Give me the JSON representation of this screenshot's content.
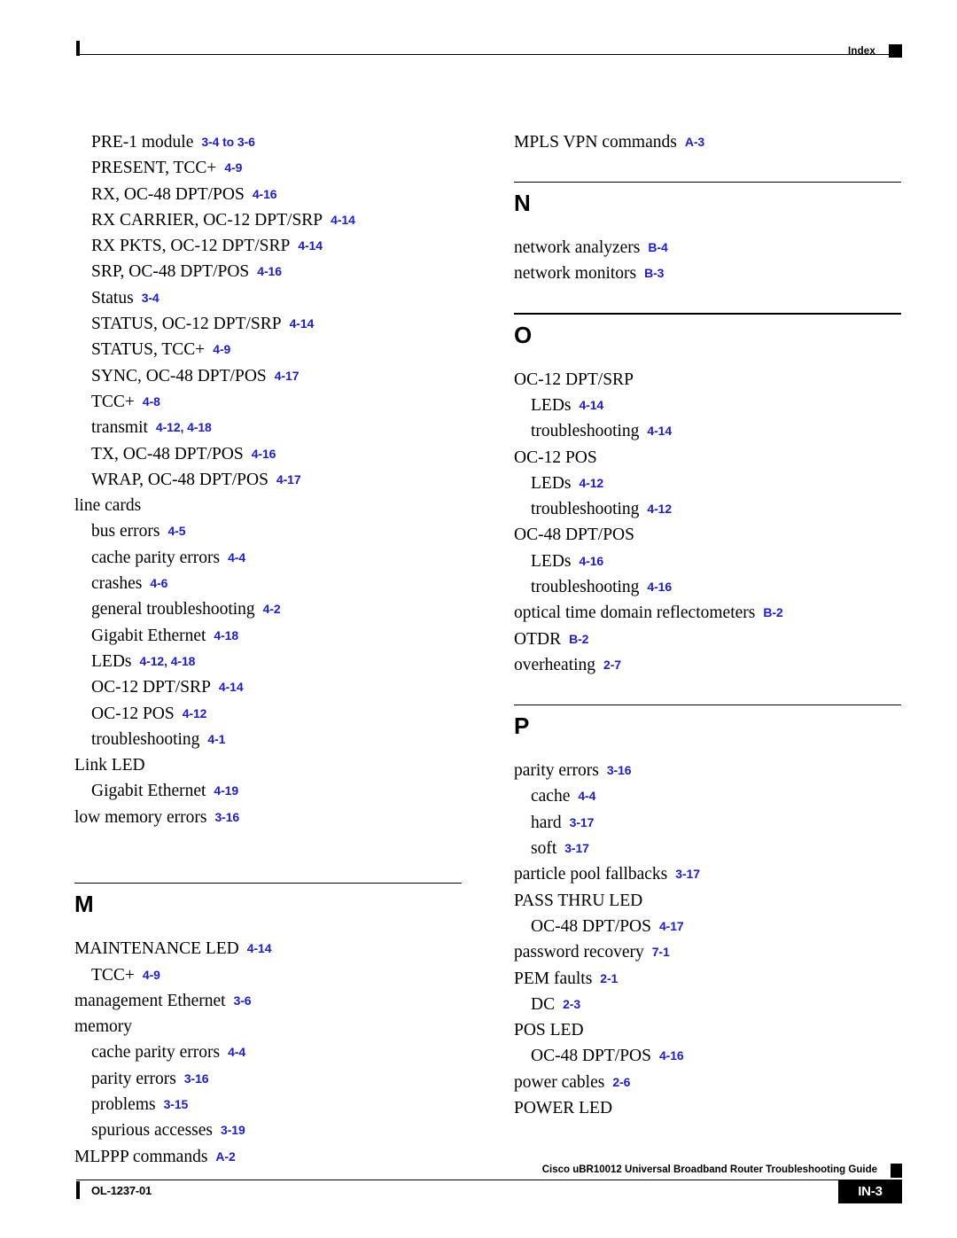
{
  "header": {
    "label": "Index",
    "marker_icon": "black-square-marker"
  },
  "footer": {
    "guide_title": "Cisco uBR10012 Universal Broadband Router Troubleshooting Guide",
    "doc_id": "OL-1237-01",
    "page_number": "IN-3",
    "marker_icon": "black-square-marker"
  },
  "columns": [
    {
      "name": "left-column",
      "blocks": [
        {
          "type": "entries",
          "entries": [
            {
              "level": 1,
              "term": "PRE-1 module",
              "locator": "3-4 to 3-6"
            },
            {
              "level": 1,
              "term": "PRESENT, TCC+",
              "locator": "4-9"
            },
            {
              "level": 1,
              "term": "RX, OC-48 DPT/POS",
              "locator": "4-16"
            },
            {
              "level": 1,
              "term": "RX CARRIER, OC-12 DPT/SRP",
              "locator": "4-14"
            },
            {
              "level": 1,
              "term": "RX PKTS, OC-12 DPT/SRP",
              "locator": "4-14"
            },
            {
              "level": 1,
              "term": "SRP, OC-48 DPT/POS",
              "locator": "4-16"
            },
            {
              "level": 1,
              "term": "Status",
              "locator": "3-4"
            },
            {
              "level": 1,
              "term": "STATUS, OC-12 DPT/SRP",
              "locator": "4-14"
            },
            {
              "level": 1,
              "term": "STATUS, TCC+",
              "locator": "4-9"
            },
            {
              "level": 1,
              "term": "SYNC, OC-48 DPT/POS",
              "locator": "4-17"
            },
            {
              "level": 1,
              "term": "TCC+",
              "locator": "4-8"
            },
            {
              "level": 1,
              "term": "transmit",
              "locator": "4-12, 4-18"
            },
            {
              "level": 1,
              "term": "TX, OC-48 DPT/POS",
              "locator": "4-16"
            },
            {
              "level": 1,
              "term": "WRAP, OC-48 DPT/POS",
              "locator": "4-17"
            },
            {
              "level": 0,
              "term": "line cards",
              "locator": ""
            },
            {
              "level": 1,
              "term": "bus errors",
              "locator": "4-5"
            },
            {
              "level": 1,
              "term": "cache parity errors",
              "locator": "4-4"
            },
            {
              "level": 1,
              "term": "crashes",
              "locator": "4-6"
            },
            {
              "level": 1,
              "term": "general troubleshooting",
              "locator": "4-2"
            },
            {
              "level": 1,
              "term": "Gigabit Ethernet",
              "locator": "4-18"
            },
            {
              "level": 1,
              "term": "LEDs",
              "locator": "4-12, 4-18"
            },
            {
              "level": 1,
              "term": "OC-12 DPT/SRP",
              "locator": "4-14"
            },
            {
              "level": 1,
              "term": "OC-12 POS",
              "locator": "4-12"
            },
            {
              "level": 1,
              "term": "troubleshooting",
              "locator": "4-1"
            },
            {
              "level": 0,
              "term": "Link LED",
              "locator": ""
            },
            {
              "level": 1,
              "term": "Gigabit Ethernet",
              "locator": "4-19"
            },
            {
              "level": 0,
              "term": "low memory errors",
              "locator": "3-16"
            }
          ]
        },
        {
          "type": "gap",
          "size": "big"
        },
        {
          "type": "alpha",
          "letter": "M"
        },
        {
          "type": "entries",
          "entries": [
            {
              "level": 0,
              "term": "MAINTENANCE LED",
              "locator": "4-14"
            },
            {
              "level": 1,
              "term": "TCC+",
              "locator": "4-9"
            },
            {
              "level": 0,
              "term": "management Ethernet",
              "locator": "3-6"
            },
            {
              "level": 0,
              "term": "memory",
              "locator": ""
            },
            {
              "level": 1,
              "term": "cache parity errors",
              "locator": "4-4"
            },
            {
              "level": 1,
              "term": "parity errors",
              "locator": "3-16"
            },
            {
              "level": 1,
              "term": "problems",
              "locator": "3-15"
            },
            {
              "level": 1,
              "term": "spurious accesses",
              "locator": "3-19"
            },
            {
              "level": 0,
              "term": "MLPPP commands",
              "locator": "A-2"
            }
          ]
        }
      ]
    },
    {
      "name": "right-column",
      "blocks": [
        {
          "type": "entries",
          "entries": [
            {
              "level": 0,
              "term": "MPLS VPN commands",
              "locator": "A-3"
            }
          ]
        },
        {
          "type": "gap",
          "size": "small"
        },
        {
          "type": "alpha",
          "letter": "N"
        },
        {
          "type": "entries",
          "entries": [
            {
              "level": 0,
              "term": "network analyzers",
              "locator": "B-4"
            },
            {
              "level": 0,
              "term": "network monitors",
              "locator": "B-3"
            }
          ]
        },
        {
          "type": "gap",
          "size": "small"
        },
        {
          "type": "alpha",
          "letter": "O"
        },
        {
          "type": "entries",
          "entries": [
            {
              "level": 0,
              "term": "OC-12 DPT/SRP",
              "locator": ""
            },
            {
              "level": 1,
              "term": "LEDs",
              "locator": "4-14"
            },
            {
              "level": 1,
              "term": "troubleshooting",
              "locator": "4-14"
            },
            {
              "level": 0,
              "term": "OC-12 POS",
              "locator": ""
            },
            {
              "level": 1,
              "term": "LEDs",
              "locator": "4-12"
            },
            {
              "level": 1,
              "term": "troubleshooting",
              "locator": "4-12"
            },
            {
              "level": 0,
              "term": "OC-48 DPT/POS",
              "locator": ""
            },
            {
              "level": 1,
              "term": "LEDs",
              "locator": "4-16"
            },
            {
              "level": 1,
              "term": "troubleshooting",
              "locator": "4-16"
            },
            {
              "level": 0,
              "term": "optical time domain reflectometers",
              "locator": "B-2"
            },
            {
              "level": 0,
              "term": "OTDR",
              "locator": "B-2"
            },
            {
              "level": 0,
              "term": "overheating",
              "locator": "2-7"
            }
          ]
        },
        {
          "type": "gap",
          "size": "small"
        },
        {
          "type": "alpha",
          "letter": "P"
        },
        {
          "type": "entries",
          "entries": [
            {
              "level": 0,
              "term": "parity errors",
              "locator": "3-16"
            },
            {
              "level": 1,
              "term": "cache",
              "locator": "4-4"
            },
            {
              "level": 1,
              "term": "hard",
              "locator": "3-17"
            },
            {
              "level": 1,
              "term": "soft",
              "locator": "3-17"
            },
            {
              "level": 0,
              "term": "particle pool fallbacks",
              "locator": "3-17"
            },
            {
              "level": 0,
              "term": "PASS THRU LED",
              "locator": ""
            },
            {
              "level": 1,
              "term": "OC-48 DPT/POS",
              "locator": "4-17"
            },
            {
              "level": 0,
              "term": "password recovery",
              "locator": "7-1"
            },
            {
              "level": 0,
              "term": "PEM faults",
              "locator": "2-1"
            },
            {
              "level": 1,
              "term": "DC",
              "locator": "2-3"
            },
            {
              "level": 0,
              "term": "POS LED",
              "locator": ""
            },
            {
              "level": 1,
              "term": "OC-48 DPT/POS",
              "locator": "4-16"
            },
            {
              "level": 0,
              "term": "power cables",
              "locator": "2-6"
            },
            {
              "level": 0,
              "term": "POWER LED",
              "locator": ""
            }
          ]
        }
      ]
    }
  ],
  "colors": {
    "locator_blue": "#1a1ae0",
    "text_black": "#000000",
    "page_background": "#ffffff"
  }
}
